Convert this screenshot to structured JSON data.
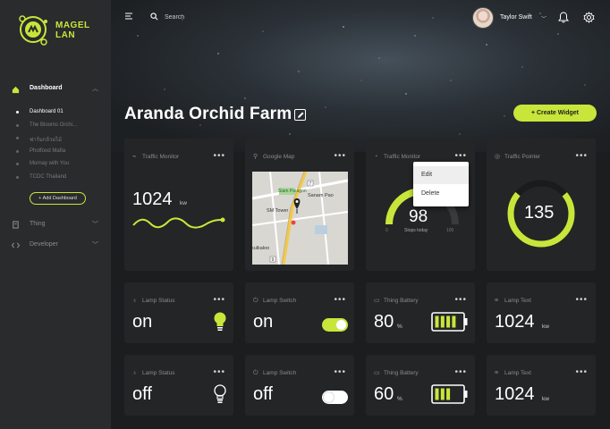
{
  "brand": {
    "line1": "MAGEL",
    "line2": "LAN",
    "color": "#c8e63a"
  },
  "sidebar": {
    "dashboard_label": "Dashboard",
    "dashboards": [
      {
        "label": "Dashboard 01",
        "active": true
      },
      {
        "label": "The Blooms Orchi..."
      },
      {
        "label": "ฟาร์มกล้วยไม้"
      },
      {
        "label": "Pholfood Mafia"
      },
      {
        "label": "Mornay with You"
      },
      {
        "label": "TCDC Thailand"
      }
    ],
    "add_dashboard": "+ Add Dashboard",
    "thing_label": "Thing",
    "developer_label": "Developer"
  },
  "header": {
    "search_placeholder": "Search",
    "user_name": "Taylor Swift"
  },
  "page": {
    "title": "Aranda Orchid Farm",
    "create_widget": "+  Create Widget"
  },
  "widgets": {
    "traffic_monitor_1": {
      "title": "Traffic Monitor",
      "value": "1024",
      "unit": "kw"
    },
    "google_map": {
      "title": "Google Map",
      "labels": [
        "Siam Paragon",
        "Sanam Pao",
        "SM Tower",
        "kulkaloo",
        "7",
        "9"
      ]
    },
    "traffic_monitor_2": {
      "title": "Traffic Monitor",
      "value": "98",
      "caption": "Stops today",
      "min": "0",
      "max": "100",
      "level": 0.98
    },
    "traffic_pointer": {
      "title": "Traffic Pointer",
      "value": "135",
      "level": 0.72
    },
    "menu": {
      "edit": "Edit",
      "delete": "Delete"
    },
    "lamp_status_1": {
      "title": "Lamp Status",
      "value": "on"
    },
    "lamp_switch_1": {
      "title": "Lamp Switch",
      "value": "on",
      "state": true
    },
    "thing_battery_1": {
      "title": "Thing Battery",
      "value": "80",
      "unit": "%",
      "level": 0.8
    },
    "lamp_text_1": {
      "title": "Lamp Text",
      "value": "1024",
      "unit": "kw"
    },
    "lamp_status_2": {
      "title": "Lamp Status",
      "value": "off"
    },
    "lamp_switch_2": {
      "title": "Lamp Switch",
      "value": "off",
      "state": false
    },
    "thing_battery_2": {
      "title": "Thing Battery",
      "value": "60",
      "unit": "%",
      "level": 0.6
    },
    "lamp_text_2": {
      "title": "Lamp Text",
      "value": "1024",
      "unit": "kw"
    }
  },
  "colors": {
    "accent": "#c8e63a",
    "card": "#242526",
    "sidebar": "#2a2b2d",
    "bg": "#1c1d1f"
  }
}
